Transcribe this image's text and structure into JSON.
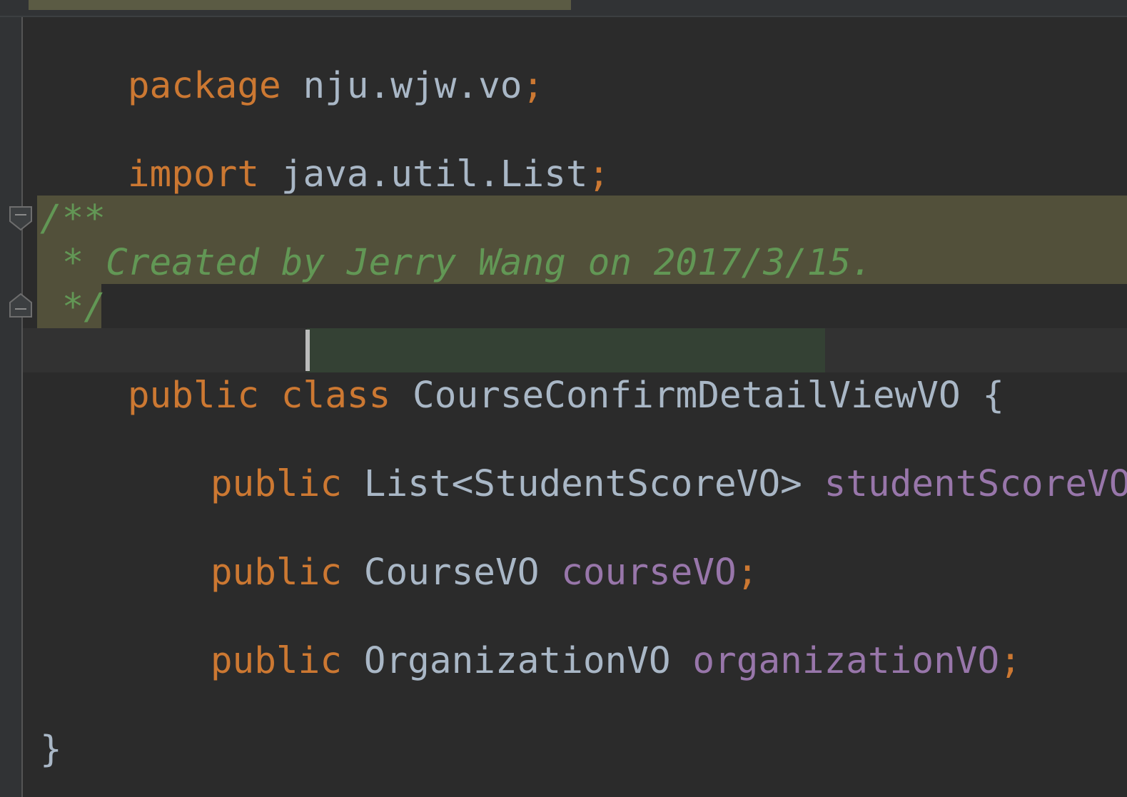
{
  "code": {
    "package_line": {
      "keyword": "package",
      "name": " nju.wjw.vo",
      "semi": ";"
    },
    "import_line": {
      "keyword": "import",
      "name": " java.util.List",
      "semi": ";"
    },
    "doc_comment": {
      "line1": "/**",
      "line2": " * Created by Jerry Wang on 2017/3/15.",
      "line3": " */"
    },
    "class_line": {
      "modifier": "public",
      "keyword": "class",
      "name": "CourseConfirmDetailViewVO",
      "brace": " {"
    },
    "fields": [
      {
        "modifier": "public",
        "type": " List<StudentScoreVO> ",
        "name": "studentScoreVOs",
        "semi": ";"
      },
      {
        "modifier": "public",
        "type": " CourseVO ",
        "name": "courseVO",
        "semi": ";"
      },
      {
        "modifier": "public",
        "type": " OrganizationVO ",
        "name": "organizationVO",
        "semi": ";"
      }
    ],
    "closing_brace": "}"
  },
  "colors": {
    "background": "#2b2b2b",
    "keyword": "#cc7832",
    "identifier": "#a9b7c6",
    "field": "#9876aa",
    "comment": "#629755",
    "comment_highlight": "#52503a",
    "identifier_highlight": "#344134"
  },
  "icons": {
    "fold_top": "fold-collapse-icon",
    "fold_bottom": "fold-end-icon"
  }
}
